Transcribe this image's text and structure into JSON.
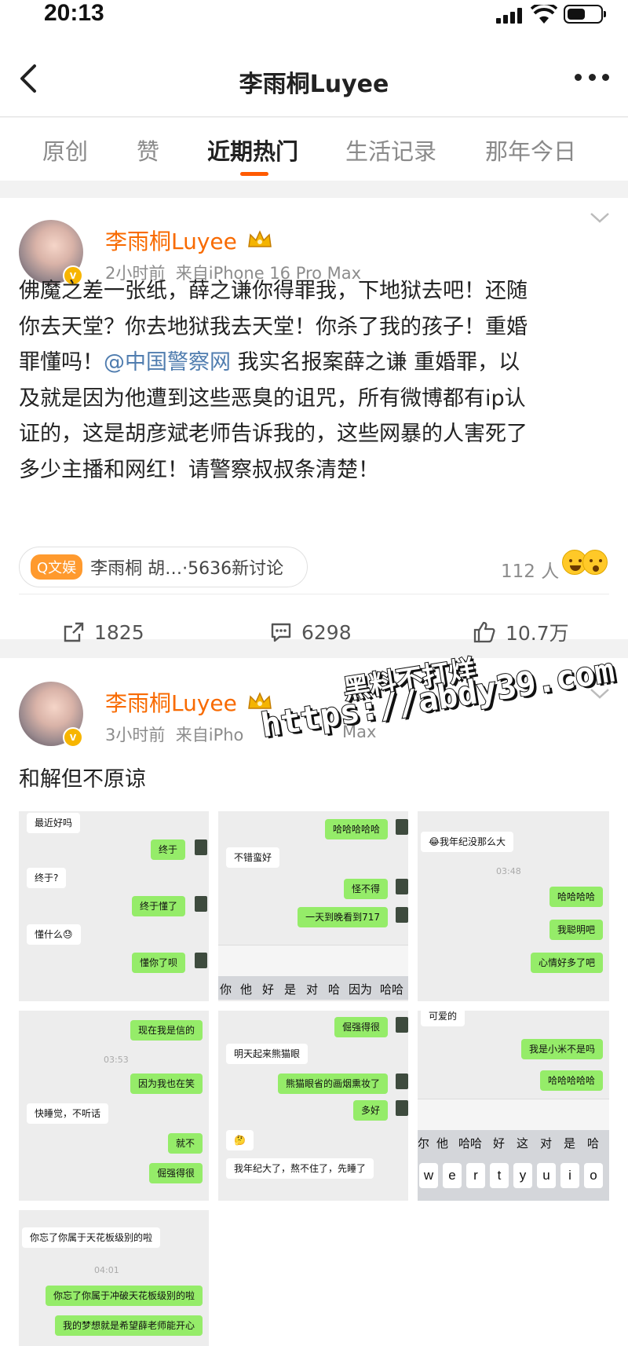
{
  "status_bar": {
    "time": "20:13"
  },
  "header": {
    "title": "李雨桐Luyee"
  },
  "tabs": [
    {
      "label": "原创"
    },
    {
      "label": "赞"
    },
    {
      "label": "近期热门"
    },
    {
      "label": "生活记录"
    },
    {
      "label": "那年今日"
    }
  ],
  "posts": [
    {
      "author": "李雨桐Luyee",
      "time": "2小时前",
      "source": "来自iPhone 16 Pro Max",
      "text_lines": [
        "佛魔之差一张纸，薛之谦你得罪我，下地狱去吧！还随",
        "你去天堂？你去地狱我去天堂！你杀了我的孩子！重婚",
        "罪懂吗！",
        "我实名报案薛之谦 重婚罪，以",
        "及就是因为他遭到这些恶臭的诅咒，所有微博都有ip认",
        "证的，这是胡彦斌老师告诉我的，这些网暴的人害死了",
        "多少主播和网红！请警察叔叔条清楚！"
      ],
      "mention": "@中国警察网",
      "topic": {
        "tag": "Q文娱",
        "text": "李雨桐 胡…·5636新讨论"
      },
      "likers": "112 人",
      "reposts": "1825",
      "comments": "6298",
      "likes": "10.7万"
    },
    {
      "author": "李雨桐Luyee",
      "time": "3小时前",
      "source": "来自iPho",
      "source_tail": "Max",
      "text": "和解但不原谅"
    }
  ],
  "watermark": {
    "line1": "黑料不打烊",
    "line2": "https://abdy39.com"
  },
  "chat": {
    "c1": [
      "最近好吗",
      "终于",
      "终于?",
      "终于懂了",
      "懂什么😓",
      "懂你了呗"
    ],
    "c2": [
      "哈哈哈哈哈",
      "不错蛮好",
      "怪不得",
      "一天到晚看到717"
    ],
    "c2_keys": [
      "你",
      "他",
      "好",
      "是",
      "对",
      "哈",
      "因为",
      "哈哈"
    ],
    "c3": [
      "😂我年纪没那么大",
      "03:48",
      "哈哈哈哈",
      "我聪明吧",
      "心情好多了吧"
    ],
    "c4": [
      "现在我是信的",
      "03:53",
      "因为我也在笑",
      "快睡觉，不听话",
      "就不",
      "倔强得很"
    ],
    "c5": [
      "倔强得很",
      "明天起来熊猫眼",
      "熊猫眼省的画烟熏妆了",
      "多好",
      "🤔",
      "我年纪大了，熬不住了，先睡了"
    ],
    "c6": [
      "可爱的",
      "我是小米不是吗",
      "哈哈哈哈哈"
    ],
    "c6_keys": [
      "尔",
      "他",
      "哈哈",
      "好",
      "这",
      "对",
      "是",
      "哈"
    ],
    "c6_letters": [
      "w",
      "e",
      "r",
      "t",
      "y",
      "u",
      "i",
      "o"
    ],
    "c7": [
      "你忘了你属于天花板级别的啦",
      "04:01",
      "你忘了你属于冲破天花板级别的啦",
      "我的梦想就是希望薛老师能开心"
    ]
  }
}
